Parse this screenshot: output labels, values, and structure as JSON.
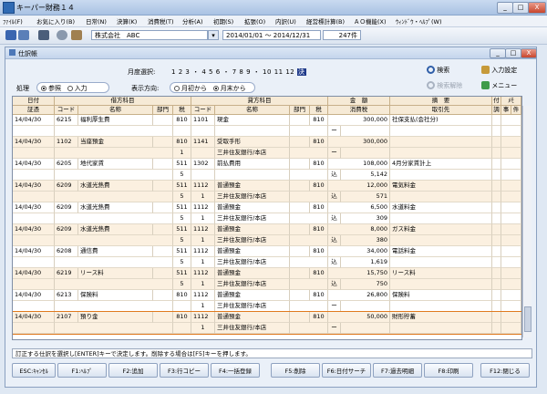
{
  "app": {
    "title": "キーパー財務１４"
  },
  "window_controls": {
    "minimize": "_",
    "maximize": "□",
    "close": "X"
  },
  "menu": [
    "ﾌｧｲﾙ(F)",
    "お気に入り(B)",
    "日常(N)",
    "決算(K)",
    "消費税(T)",
    "分析(A)",
    "初期(S)",
    "拡張(O)",
    "内訳(U)",
    "経営標計算(B)",
    "ＡＯ機能(X)",
    "ｳｨﾝﾄﾞｳ・ﾍﾙﾌﾟ(W)"
  ],
  "toolbar": {
    "company": "株式会社　ABC",
    "period": "2014/01/01 ～ 2014/12/31",
    "count": "247件"
  },
  "journal": {
    "window_title": "仕訳帳",
    "month_label": "月度選択:",
    "months": [
      "1",
      "2",
      "3",
      "・",
      "4",
      "5",
      "6",
      "・",
      "7",
      "8",
      "9",
      "・",
      "10",
      "11",
      "12",
      "決"
    ],
    "process_label": "処理",
    "process_opts": [
      "参照",
      "入力"
    ],
    "direction_label": "表示方向:",
    "direction_opts": [
      "月初から",
      "月末から"
    ],
    "search": "検索",
    "search_release": "検索解除",
    "input_settings": "入力設定",
    "menu": "メニュー"
  },
  "grid": {
    "top_headers": {
      "date": "日付",
      "debit": "借方科目",
      "credit": "貸方科目",
      "amount": "金　額",
      "summary": "摘　要",
      "att": "付",
      "memo": "ﾒﾓ"
    },
    "sub_headers": {
      "voucher": "証憑",
      "code": "コード",
      "name": "名称",
      "dept": "部門",
      "tax": "税",
      "ccode": "コード",
      "cname": "名称",
      "cdept": "部門",
      "ctax": "税",
      "consumption": "消費税",
      "partner": "取引先",
      "chk": "調",
      "matter": "事",
      "tail": "件"
    },
    "rows": [
      {
        "date": "14/04/30",
        "voucher": "",
        "dcode": "6215",
        "dname": "福利厚生費",
        "dtax": "810",
        "ccode": "1101",
        "cname": "現金",
        "ctax": "810",
        "amount": "300,000",
        "summary": "社保支払(会社分)",
        "stripe": false,
        "sub": {
          "dtax": "",
          "ccode": "",
          "cname": "",
          "mark": "ー",
          "tax": ""
        }
      },
      {
        "date": "14/04/30",
        "voucher": "",
        "dcode": "1102",
        "dname": "当座預金",
        "dtax": "810",
        "ccode": "1141",
        "cname": "受取手形",
        "ctax": "810",
        "amount": "300,000",
        "summary": "",
        "stripe": true,
        "sub": {
          "dtax": "1",
          "ccode": "",
          "cname": "三井住友銀行/本店",
          "mark": "ー",
          "tax": ""
        }
      },
      {
        "date": "14/04/30",
        "voucher": "",
        "dcode": "6205",
        "dname": "地代家賃",
        "dtax": "511",
        "ccode": "1302",
        "cname": "前払費用",
        "ctax": "810",
        "amount": "108,000",
        "summary": "4月分家賃計上",
        "stripe": false,
        "sub": {
          "dtax": "5",
          "ccode": "",
          "cname": "",
          "mark": "込",
          "tax": "5,142"
        }
      },
      {
        "date": "14/04/30",
        "voucher": "",
        "dcode": "6209",
        "dname": "水道光熱費",
        "dtax": "511",
        "ccode": "1112",
        "cname": "普通預金",
        "ctax": "810",
        "amount": "12,000",
        "summary": "電気料金",
        "stripe": true,
        "sub": {
          "dtax": "5",
          "ccode": "1",
          "cname": "三井住友銀行/本店",
          "mark": "込",
          "tax": "571"
        }
      },
      {
        "date": "14/04/30",
        "voucher": "",
        "dcode": "6209",
        "dname": "水道光熱費",
        "dtax": "511",
        "ccode": "1112",
        "cname": "普通預金",
        "ctax": "810",
        "amount": "6,500",
        "summary": "水道料金",
        "stripe": false,
        "sub": {
          "dtax": "5",
          "ccode": "1",
          "cname": "三井住友銀行/本店",
          "mark": "込",
          "tax": "309"
        }
      },
      {
        "date": "14/04/30",
        "voucher": "",
        "dcode": "6209",
        "dname": "水道光熱費",
        "dtax": "511",
        "ccode": "1112",
        "cname": "普通預金",
        "ctax": "810",
        "amount": "8,000",
        "summary": "ガス料金",
        "stripe": true,
        "sub": {
          "dtax": "5",
          "ccode": "1",
          "cname": "三井住友銀行/本店",
          "mark": "込",
          "tax": "380"
        }
      },
      {
        "date": "14/04/30",
        "voucher": "",
        "dcode": "6208",
        "dname": "通信費",
        "dtax": "511",
        "ccode": "1112",
        "cname": "普通預金",
        "ctax": "810",
        "amount": "34,000",
        "summary": "電話料金",
        "stripe": false,
        "sub": {
          "dtax": "5",
          "ccode": "1",
          "cname": "三井住友銀行/本店",
          "mark": "込",
          "tax": "1,619"
        }
      },
      {
        "date": "14/04/30",
        "voucher": "",
        "dcode": "6219",
        "dname": "リース料",
        "dtax": "511",
        "ccode": "1112",
        "cname": "普通預金",
        "ctax": "810",
        "amount": "15,750",
        "summary": "リース料",
        "stripe": true,
        "sub": {
          "dtax": "5",
          "ccode": "1",
          "cname": "三井住友銀行/本店",
          "mark": "込",
          "tax": "750"
        }
      },
      {
        "date": "14/04/30",
        "voucher": "",
        "dcode": "6213",
        "dname": "保険料",
        "dtax": "810",
        "ccode": "1112",
        "cname": "普通預金",
        "ctax": "810",
        "amount": "26,800",
        "summary": "保険料",
        "stripe": false,
        "sub": {
          "dtax": "",
          "ccode": "1",
          "cname": "三井住友銀行/本店",
          "mark": "ー",
          "tax": ""
        }
      },
      {
        "date": "14/04/30",
        "voucher": "",
        "dcode": "2107",
        "dname": "預り金",
        "dtax": "810",
        "ccode": "1112",
        "cname": "普通預金",
        "ctax": "810",
        "amount": "50,000",
        "summary": "財形貯蓄",
        "stripe": true,
        "selected": true,
        "sub": {
          "dtax": "",
          "ccode": "1",
          "cname": "三井住友銀行/本店",
          "mark": "ー",
          "tax": ""
        }
      }
    ]
  },
  "status_text": "訂正する仕訳を選択し[ENTER]キーで決定します。削除する場合は[F5]キーを押します。",
  "fkeys": [
    "ESC:ｷｬﾝｾﾙ",
    "F1:ﾍﾙﾌﾟ",
    "F2:追加",
    "F3:行コピー",
    "F4:一括登録",
    "F5:削除",
    "F6:日付サーチ",
    "F7:過去明細",
    "F8:印刷",
    "F12:閉じる"
  ],
  "colors": {
    "header_bg": "#f6ead6",
    "stripe": "#fbf0e0",
    "selected_border": "#e07a1e",
    "month_active": "#1f3a8a"
  }
}
